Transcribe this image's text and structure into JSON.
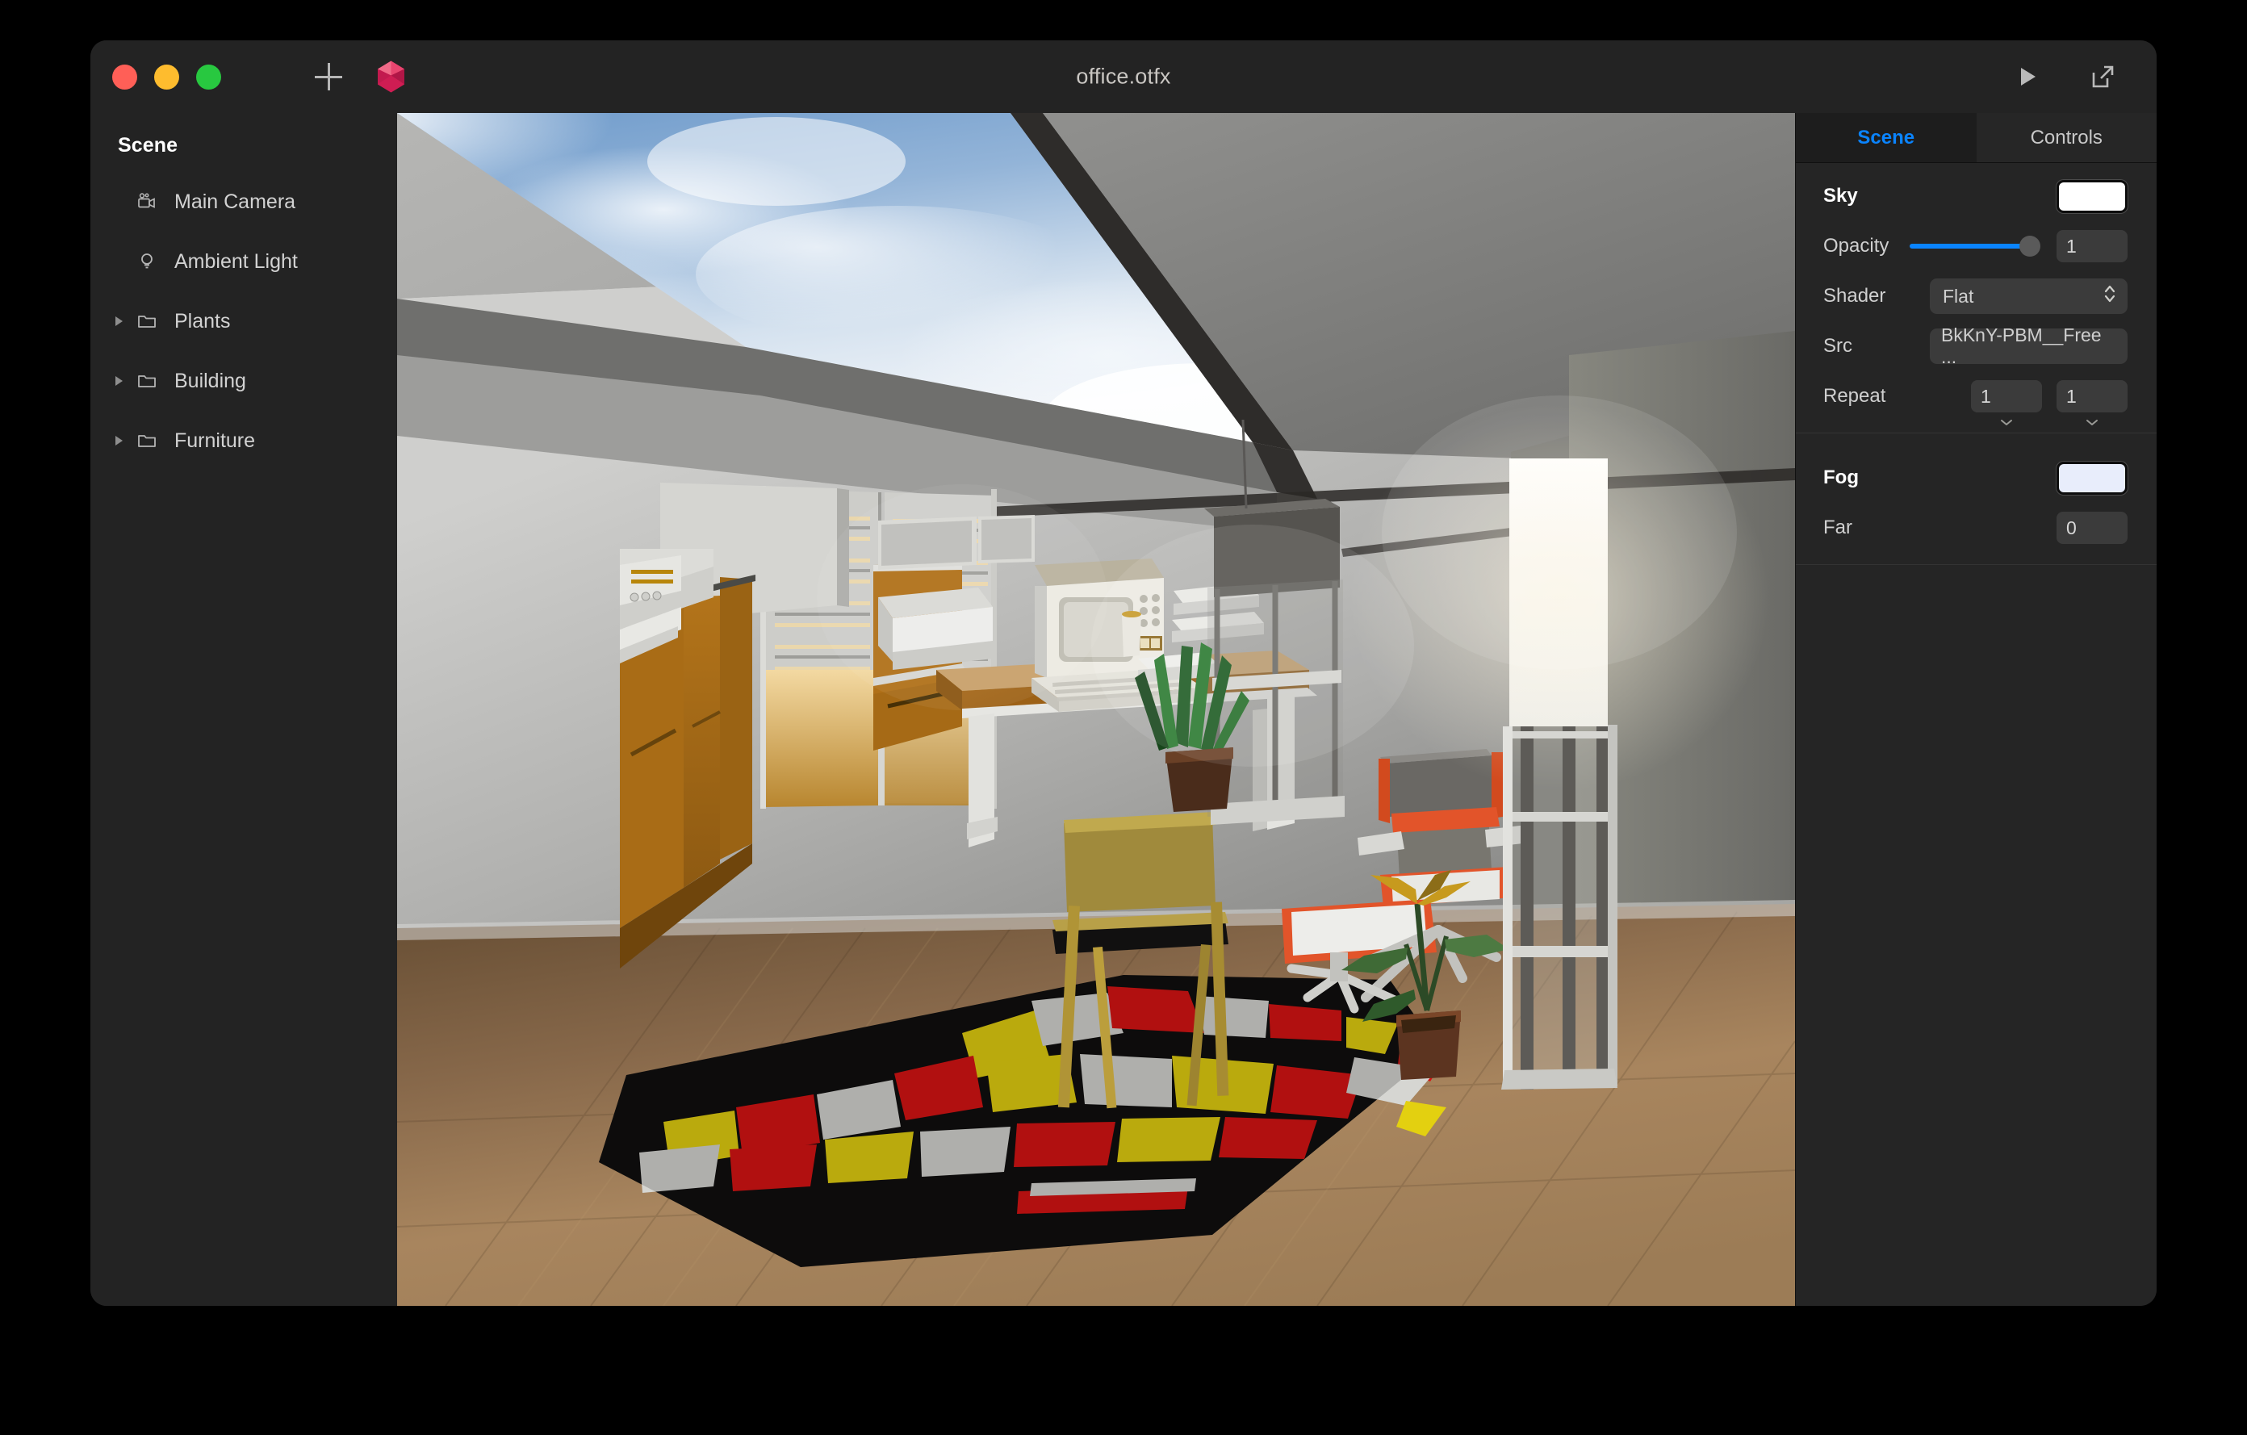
{
  "window": {
    "title": "office.otfx",
    "traffic_lights": [
      "close-red",
      "minimize-yellow",
      "zoom-green"
    ],
    "add_label": "+",
    "app_icon": "icosahedron-icon",
    "play_label": "play-icon",
    "export_label": "export-icon"
  },
  "sidebar": {
    "header": "Scene",
    "items": [
      {
        "label": "Main Camera",
        "icon": "camera-icon",
        "twisty": false
      },
      {
        "label": "Ambient Light",
        "icon": "bulb-icon",
        "twisty": false
      },
      {
        "label": "Plants",
        "icon": "folder-icon",
        "twisty": true
      },
      {
        "label": "Building",
        "icon": "folder-icon",
        "twisty": true
      },
      {
        "label": "Furniture",
        "icon": "folder-icon",
        "twisty": true
      }
    ]
  },
  "inspector": {
    "tabs": [
      {
        "label": "Scene",
        "active": true
      },
      {
        "label": "Controls",
        "active": false
      }
    ],
    "sky": {
      "title": "Sky",
      "color": "#ffffff",
      "opacity_label": "Opacity",
      "opacity_value": "1",
      "opacity_percent": 100,
      "shader_label": "Shader",
      "shader_value": "Flat",
      "shader_options": [
        "Flat"
      ],
      "src_label": "Src",
      "src_value": "BkKnY-PBM__Free ...",
      "repeat_label": "Repeat",
      "repeat_u": "1",
      "repeat_v": "1"
    },
    "fog": {
      "title": "Fog",
      "color": "#e8edfb",
      "far_label": "Far",
      "far_value": "0"
    }
  },
  "viewport": {
    "name": "3d-scene-viewport",
    "description": "Rendered 3D office interior with skylight, desk, computer, rug, lounge chair, shelving and plants",
    "accent_blue": "#0a84ff",
    "palette": {
      "sky_blue": "#7aa3cf",
      "cloud_white": "#eef3f9",
      "ceiling_gray": "#a9a9a8",
      "wall_gray": "#b7b7b5",
      "floor_wood": "#9b7a54",
      "cabinet_orange": "#a66a16",
      "rug_black": "#100f0f",
      "rug_red": "#d81414",
      "rug_yellow": "#e3d010",
      "rug_white": "#d6d6d6",
      "chair_orange": "#e2542a",
      "plant_green": "#2e6b2e",
      "pot_brown": "#4a2c1b"
    }
  }
}
